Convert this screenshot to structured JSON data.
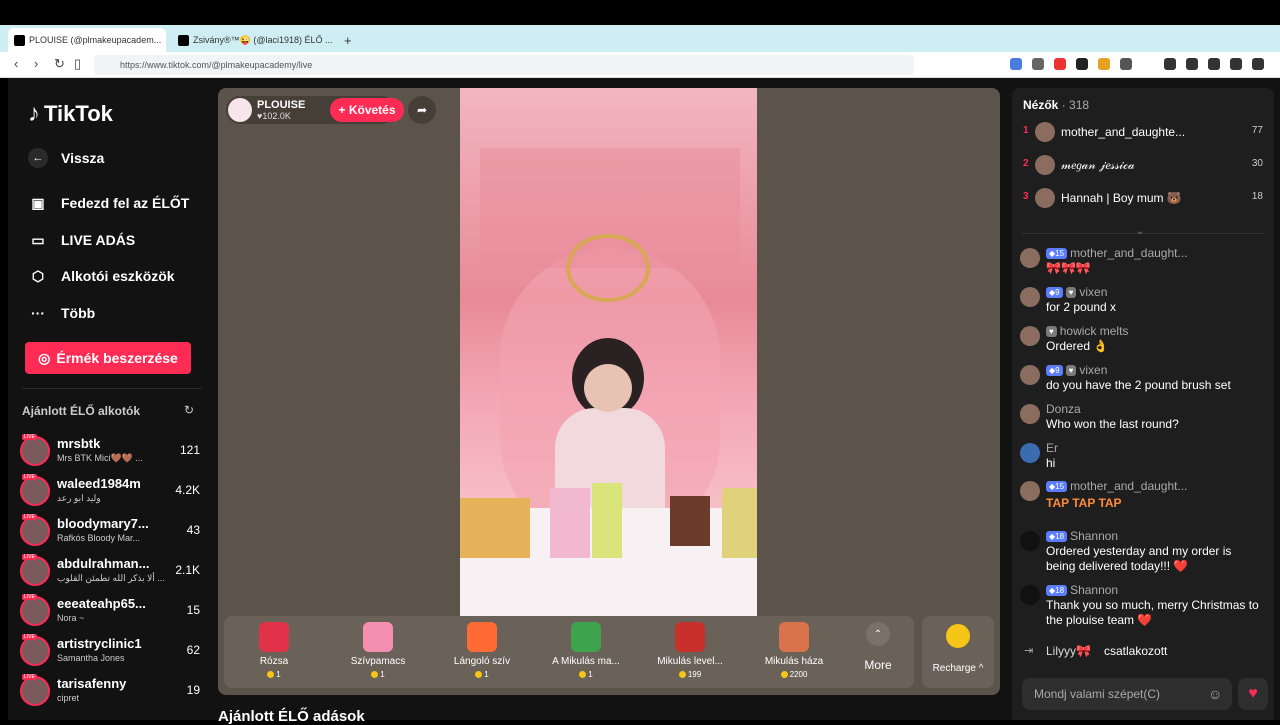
{
  "browser": {
    "tabs": [
      {
        "label": "PLOUISE (@plmakeupacadem..."
      },
      {
        "label": "Zsivány®™😜 (@laci1918) ÉLŐ ..."
      }
    ],
    "url": "https://www.tiktok.com/@plmakeupacademy/live"
  },
  "sidebar": {
    "logo": "TikTok",
    "back": "Vissza",
    "nav": [
      {
        "label": "Fedezd fel az ÉLŐT"
      },
      {
        "label": "LIVE ADÁS"
      },
      {
        "label": "Alkotói eszközök"
      },
      {
        "label": "Több"
      }
    ],
    "coins_button": "Érmék beszerzése",
    "recommended_title": "Ajánlott ÉLŐ alkotók",
    "live_badge": "LIVE",
    "creators": [
      {
        "name": "mrsbtk",
        "sub": "Mrs BTK Mici🤎🤎 ...",
        "count": "121"
      },
      {
        "name": "waleed1984m",
        "sub": "وليد ابو رعد",
        "count": "4.2K"
      },
      {
        "name": "bloodymary7...",
        "sub": "Rafkós Bloody Mar...",
        "count": "43"
      },
      {
        "name": "abdulrahman...",
        "sub": "ألا بذكر الله تطمئن القلوب ...",
        "count": "2.1K"
      },
      {
        "name": "eeeateahp65...",
        "sub": "Nora ~",
        "count": "15"
      },
      {
        "name": "artistryclinic1",
        "sub": "Samantha Jones",
        "count": "62"
      },
      {
        "name": "tarisafenny",
        "sub": "cipret",
        "count": "19"
      }
    ]
  },
  "stage": {
    "host_name": "PLOUISE",
    "host_likes": "♥102.0K",
    "follow": "+ Követés",
    "recommended_lives": "Ajánlott ÉLŐ adások",
    "gifts": [
      {
        "name": "Rózsa",
        "price": "1",
        "color": "#e0334a"
      },
      {
        "name": "Szívpamacs",
        "price": "1",
        "color": "#f48fb1"
      },
      {
        "name": "Lángoló szív",
        "price": "1",
        "color": "#ff6b35"
      },
      {
        "name": "A Mikulás ma...",
        "price": "1",
        "color": "#3fa34d"
      },
      {
        "name": "Mikulás level...",
        "price": "199",
        "color": "#c9302c"
      },
      {
        "name": "Mikulás háza",
        "price": "2200",
        "color": "#d9734b"
      }
    ],
    "more": "More",
    "recharge": "Recharge ^"
  },
  "chat": {
    "viewers_label": "Nézők",
    "viewers_count": "· 318",
    "top_viewers": [
      {
        "rank": "1",
        "name": "mother_and_daughte...",
        "score": "77"
      },
      {
        "rank": "2",
        "name": "𝓂𝑒𝑔𝒶𝓃 𝒿𝑒𝓈𝓈𝒾𝒸𝒶",
        "score": "30"
      },
      {
        "rank": "3",
        "name": "Hannah | Boy mum 🐻",
        "score": "18"
      }
    ],
    "messages": [
      {
        "lvl": "15",
        "name": "mother_and_daught...",
        "text": "🎀🎀🎀"
      },
      {
        "lvl": "9",
        "name": "vixen",
        "text": "for 2 pound x"
      },
      {
        "lvl": "",
        "name": "howick melts",
        "text": "Ordered 👌"
      },
      {
        "lvl": "9",
        "name": "vixen",
        "text": "do you have the 2 pound brush set"
      },
      {
        "lvl": "",
        "name": "Donza",
        "text": "Who won the last round?"
      },
      {
        "lvl": "",
        "name": "Er",
        "text": "hi"
      },
      {
        "lvl": "15",
        "name": "mother_and_daught...",
        "text": "TAP TAP TAP"
      },
      {
        "lvl": "18",
        "name": "Shannon",
        "text": "Ordered yesterday and my order is being delivered today!!! ❤️"
      },
      {
        "lvl": "18",
        "name": "Shannon",
        "text": "Thank you so much, merry Christmas to the plouise team ❤️"
      }
    ],
    "join_name": "Lilyyy🎀",
    "join_text": "csatlakozott",
    "input_placeholder": "Mondj valami szépet(C)"
  }
}
